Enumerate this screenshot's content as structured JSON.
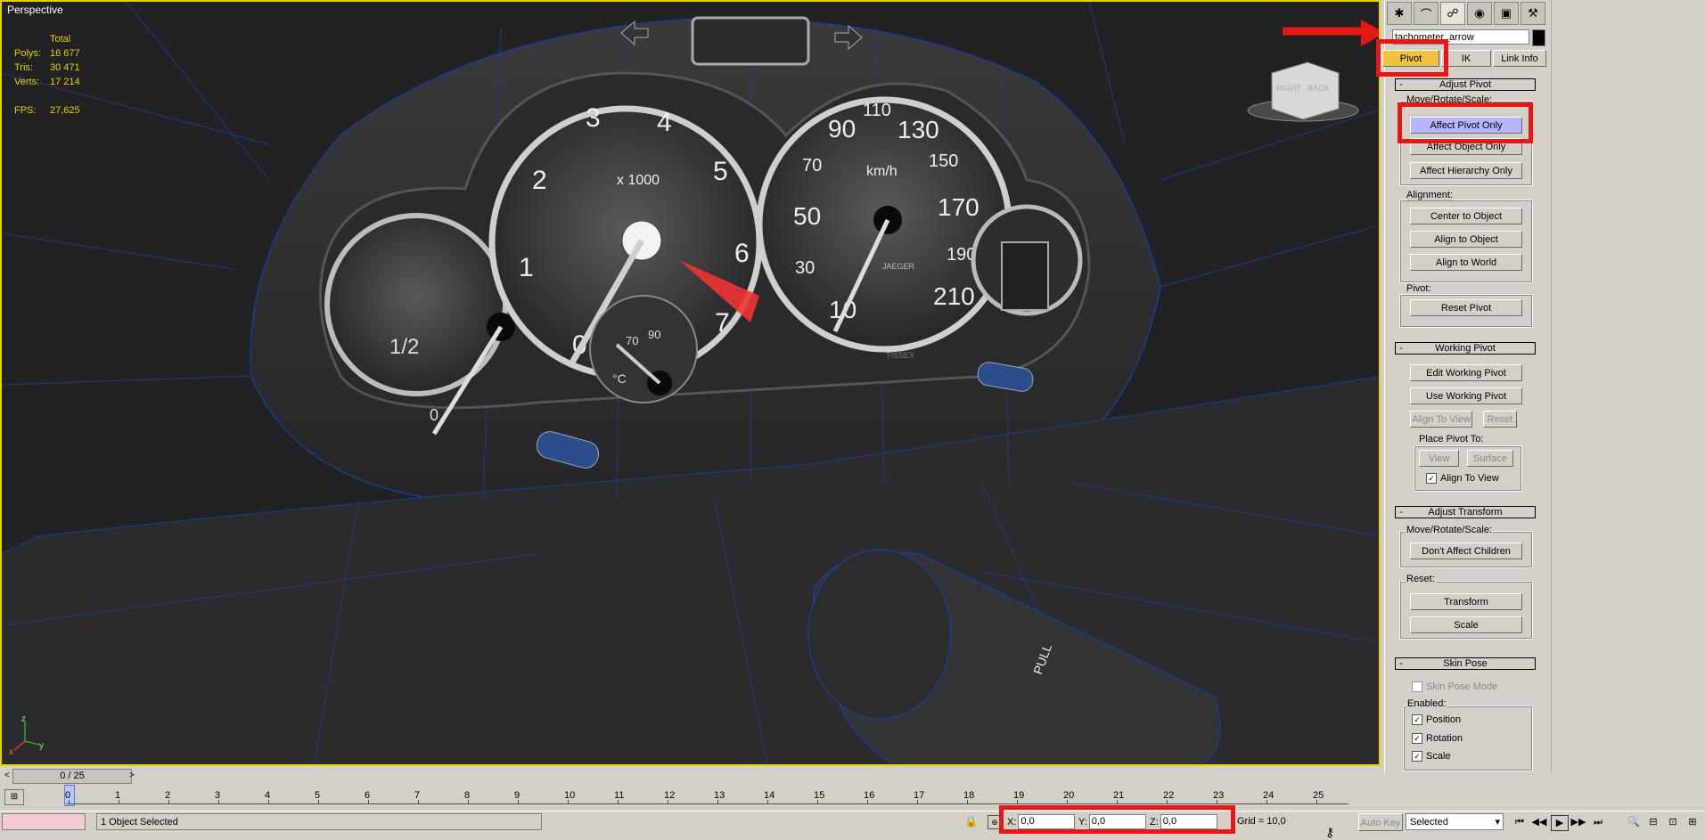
{
  "viewport": {
    "label": "Perspective",
    "stats": {
      "header": "Total",
      "rows": [
        {
          "k": "Polys:",
          "v": "16 677"
        },
        {
          "k": "Tris:",
          "v": "30 471"
        },
        {
          "k": "Verts:",
          "v": "17 214"
        }
      ],
      "fps_label": "FPS:",
      "fps_value": "27,625"
    },
    "gauges": {
      "tach_numbers": [
        "1",
        "2",
        "3",
        "4",
        "5",
        "6",
        "7",
        "0"
      ],
      "tach_unit": "x 1000",
      "speed_numbers": [
        "10",
        "30",
        "50",
        "70",
        "90",
        "110",
        "130",
        "150",
        "170",
        "190",
        "210"
      ],
      "speed_unit": "km/h",
      "fuel_half": "1/2",
      "fuel_zero": "0",
      "temp_unit": "°C",
      "temp_low": "70",
      "temp_high": "90",
      "stalk_label": "PULL",
      "brand_small": "JAEGER",
      "speed_brand": "TISSEX"
    },
    "viewcube": {
      "right": "RIGHT",
      "back": "BACK"
    },
    "gizmo": {
      "x": "x",
      "y": "y",
      "z": "z"
    }
  },
  "command_panel": {
    "tabs": [
      "create-icon",
      "modify-icon",
      "hierarchy-icon",
      "motion-icon",
      "display-icon",
      "utilities-icon"
    ],
    "object_name": "tachometer_arrow",
    "subtabs": {
      "pivot": "Pivot",
      "ik": "IK",
      "link_info": "Link Info"
    },
    "adjust_pivot": {
      "title": "Adjust Pivot",
      "move_rotate_scale": "Move/Rotate/Scale:",
      "affect_pivot_only": "Affect Pivot Only",
      "affect_object_only": "Affect Object Only",
      "affect_hierarchy_only": "Affect Hierarchy Only",
      "alignment_label": "Alignment:",
      "center_to_object": "Center to Object",
      "align_to_object": "Align to Object",
      "align_to_world": "Align to World",
      "pivot_label": "Pivot:",
      "reset_pivot": "Reset Pivot"
    },
    "working_pivot": {
      "title": "Working Pivot",
      "edit_working_pivot": "Edit Working Pivot",
      "use_working_pivot": "Use Working Pivot",
      "align_to_view": "Align To View",
      "reset": "Reset",
      "place_pivot_to": "Place Pivot To:",
      "view": "View",
      "surface": "Surface",
      "align_to_view_checkbox": "Align To View"
    },
    "adjust_transform": {
      "title": "Adjust Transform",
      "move_rotate_scale": "Move/Rotate/Scale:",
      "dont_affect_children": "Don't Affect Children",
      "reset_label": "Reset:",
      "transform": "Transform",
      "scale": "Scale"
    },
    "skin_pose": {
      "title": "Skin Pose",
      "skin_pose_mode": "Skin Pose Mode",
      "enabled_label": "Enabled:",
      "position": "Position",
      "rotation": "Rotation",
      "scale": "Scale"
    }
  },
  "timeline": {
    "frame_display": "0 / 25",
    "prev": "<",
    "next": ">",
    "ticks": [
      "0",
      "1",
      "2",
      "3",
      "4",
      "5",
      "6",
      "7",
      "8",
      "9",
      "10",
      "11",
      "12",
      "13",
      "14",
      "15",
      "16",
      "17",
      "18",
      "19",
      "20",
      "21",
      "22",
      "23",
      "24",
      "25"
    ]
  },
  "status_bar": {
    "selection_text": "1 Object Selected",
    "x_label": "X:",
    "x_value": "0,0",
    "y_label": "Y:",
    "y_value": "0,0",
    "z_label": "Z:",
    "z_value": "0,0",
    "grid": "Grid = 10,0",
    "auto_key": "Auto Key",
    "selected_dropdown": "Selected"
  },
  "colors": {
    "annotation_red": "#e51717",
    "viewport_border": "#e8d200",
    "stats_text": "#e8d200",
    "active_button": "#b6b6ff",
    "pivot_tab": "#f2c23e"
  }
}
